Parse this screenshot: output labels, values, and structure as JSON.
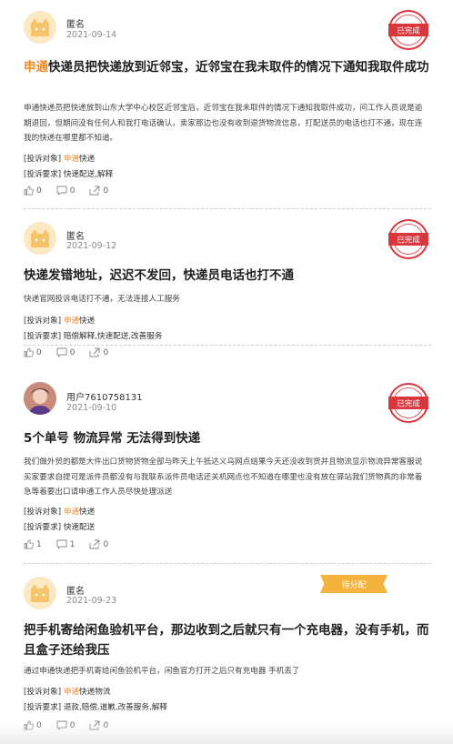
{
  "brand": {
    "accent": "#f08a24",
    "stamp": "#d9363e",
    "pending": "#f3b33d"
  },
  "complaints": [
    {
      "user": "匿名",
      "date": "2021-09-14",
      "avatar": "cat-avatar",
      "status": "已完成",
      "title_brand": "申通",
      "title_rest": "快递员把快递放到近邻宝，近邻宝在我未取件的情况下通知我取件成功",
      "description": "申通快递员把快递放到山东大学中心校区近邻宝后，近邻宝在我未取件的情况下通知我取件成功，问工作人员说是逾期退回，但期间没有任何人和我打电话确认，卖家那边也没有收到退货物流信息，打配送员的电话也打不通，现在连我的快递在哪里都不知道。",
      "target_label": "[投诉对象]",
      "target_brand": "申通",
      "target_rest": "快递",
      "request_label": "[投诉要求]",
      "request": "快速配送,解释",
      "likes": "0",
      "comments": "0",
      "shares": "0"
    },
    {
      "user": "匿名",
      "date": "2021-09-12",
      "avatar": "cat-avatar",
      "status": "已完成",
      "title_brand": "",
      "title_rest": "快递发错地址，迟迟不发回，快递员电话也打不通",
      "description": "快递官网投诉电话打不通，无法连接人工服务",
      "target_label": "[投诉对象]",
      "target_brand": "申通",
      "target_rest": "快递",
      "request_label": "[投诉要求]",
      "request": "赔偿解释,快速配送,改善服务",
      "likes": "0",
      "comments": "0",
      "shares": "0"
    },
    {
      "user": "用户7610758131",
      "date": "2021-09-10",
      "avatar": "photo-avatar",
      "status": "已完成",
      "title_brand": "",
      "title_rest": "5个单号 物流异常 无法得到快递",
      "description": "我们做外贸的都是大件出口货物货物全部与昨天上午抵达义乌网点结果今天还没收到货并且物流显示物流异常客服说 买家要求自提可是派件员都没有与我联系派件员电话还关机网点也不知道在哪里也没有放在驿站我们货物真的非常着急等着要出口请申通工作人员尽快处理派送",
      "target_label": "[投诉对象]",
      "target_brand": "申通",
      "target_rest": "快递",
      "request_label": "[投诉要求]",
      "request": "快速配送",
      "likes": "1",
      "comments": "1",
      "shares": "0"
    },
    {
      "user": "匿名",
      "date": "2021-09-23",
      "avatar": "cat-avatar",
      "status": "待分配",
      "title_brand": "",
      "title_rest": "把手机寄给闲鱼验机平台，那边收到之后就只有一个充电器，没有手机，而且盒子还给我压",
      "description": "通过申通快递把手机寄给闲鱼验机平台，闲鱼官方打开之后只有充电器 手机丢了",
      "target_label": "[投诉对象]",
      "target_brand": "申通",
      "target_rest": "快递物流",
      "request_label": "[投诉要求]",
      "request": "退款,赔偿,道歉,改善服务,解释",
      "likes": "0",
      "comments": "0",
      "shares": "0"
    }
  ]
}
